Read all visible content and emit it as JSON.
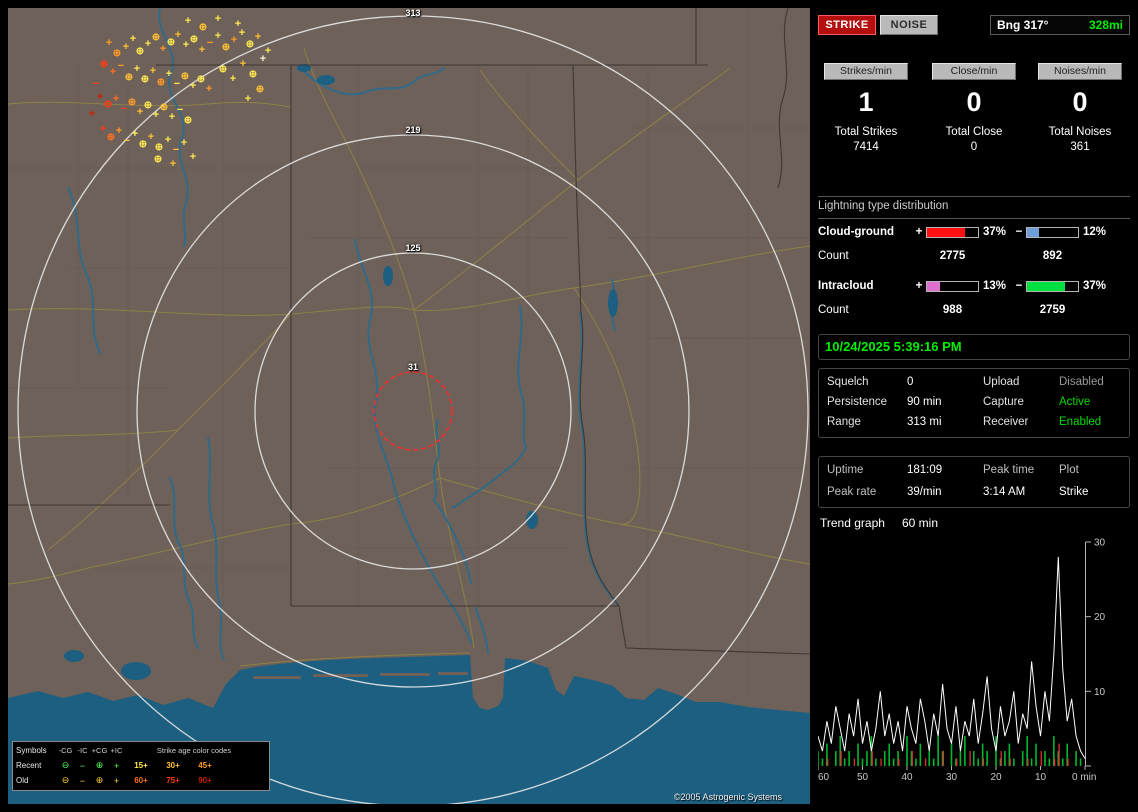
{
  "map": {
    "ring_labels": [
      "313",
      "219",
      "125",
      "31"
    ],
    "copyright": "©2005 Astrogenic Systems",
    "colors": {
      "land": "#6e6159",
      "water": "#1c5f80",
      "river": "#2d6b8c",
      "ring": "#e8e8e8",
      "alarm_ring": "#ff2a2a",
      "road": "#9b8f3d",
      "state_border": "#3b3633"
    },
    "age_palette": {
      "Y": "#ffe84f",
      "L": "#ffc133",
      "O": "#ff9a26",
      "D": "#ff6f1c",
      "R": "#ff3b12",
      "K": "#cc1e00",
      "W": "#fff3cf"
    },
    "legend": {
      "symbols_header": "Symbols",
      "col_headers": [
        "-CG",
        "-IC",
        "+CG",
        "+IC"
      ],
      "symbol_glyphs": [
        "⊖",
        "−",
        "⊕",
        "+"
      ],
      "age_header": "Strike age color codes",
      "rows": [
        {
          "label": "Recent",
          "ages": [
            "15+",
            "30+",
            "45+"
          ]
        },
        {
          "label": "Old",
          "ages": [
            "60+",
            "75+",
            "90+"
          ]
        }
      ],
      "age_colors": [
        "#ffe84f",
        "#ffc133",
        "#ff9a26",
        "#ff6f1c",
        "#ff3b12",
        "#cc1e00"
      ],
      "recent_symbol_color": "#55ff55",
      "old_symbol_color": "#ffd24a"
    },
    "strikes": [
      [
        101,
        34,
        "+",
        "O"
      ],
      [
        109,
        44,
        "⊕",
        "O"
      ],
      [
        118,
        38,
        "+",
        "L"
      ],
      [
        125,
        30,
        "+",
        "Y"
      ],
      [
        132,
        42,
        "⊕",
        "Y"
      ],
      [
        140,
        35,
        "+",
        "Y"
      ],
      [
        148,
        28,
        "⊕",
        "L"
      ],
      [
        155,
        40,
        "+",
        "O"
      ],
      [
        163,
        33,
        "⊕",
        "Y"
      ],
      [
        170,
        26,
        "+",
        "L"
      ],
      [
        178,
        36,
        "+",
        "Y"
      ],
      [
        186,
        30,
        "⊕",
        "Y"
      ],
      [
        194,
        41,
        "+",
        "L"
      ],
      [
        202,
        34,
        "−",
        "O"
      ],
      [
        210,
        27,
        "+",
        "Y"
      ],
      [
        218,
        38,
        "⊕",
        "L"
      ],
      [
        226,
        31,
        "+",
        "O"
      ],
      [
        234,
        24,
        "+",
        "Y"
      ],
      [
        242,
        35,
        "⊕",
        "Y"
      ],
      [
        250,
        28,
        "+",
        "L"
      ],
      [
        96,
        55,
        "⊕",
        "R"
      ],
      [
        105,
        63,
        "+",
        "D"
      ],
      [
        113,
        57,
        "−",
        "O"
      ],
      [
        121,
        68,
        "⊕",
        "L"
      ],
      [
        129,
        60,
        "+",
        "Y"
      ],
      [
        137,
        70,
        "⊕",
        "Y"
      ],
      [
        145,
        62,
        "+",
        "L"
      ],
      [
        153,
        73,
        "⊕",
        "O"
      ],
      [
        161,
        65,
        "+",
        "Y"
      ],
      [
        169,
        75,
        "−",
        "Y"
      ],
      [
        177,
        67,
        "⊕",
        "L"
      ],
      [
        185,
        77,
        "+",
        "Y"
      ],
      [
        193,
        70,
        "⊕",
        "Y"
      ],
      [
        201,
        80,
        "+",
        "O"
      ],
      [
        92,
        88,
        "+",
        "K"
      ],
      [
        100,
        95,
        "⊕",
        "R"
      ],
      [
        108,
        90,
        "+",
        "D"
      ],
      [
        116,
        100,
        "−",
        "R"
      ],
      [
        124,
        93,
        "⊕",
        "O"
      ],
      [
        132,
        103,
        "+",
        "L"
      ],
      [
        140,
        96,
        "⊕",
        "Y"
      ],
      [
        148,
        106,
        "+",
        "Y"
      ],
      [
        156,
        98,
        "⊕",
        "L"
      ],
      [
        164,
        108,
        "+",
        "Y"
      ],
      [
        172,
        101,
        "−",
        "Y"
      ],
      [
        180,
        111,
        "⊕",
        "Y"
      ],
      [
        95,
        120,
        "+",
        "R"
      ],
      [
        103,
        128,
        "⊕",
        "D"
      ],
      [
        111,
        122,
        "+",
        "O"
      ],
      [
        119,
        132,
        "−",
        "L"
      ],
      [
        127,
        125,
        "+",
        "Y"
      ],
      [
        135,
        135,
        "⊕",
        "Y"
      ],
      [
        143,
        128,
        "+",
        "L"
      ],
      [
        151,
        138,
        "⊕",
        "Y"
      ],
      [
        160,
        131,
        "+",
        "Y"
      ],
      [
        168,
        141,
        "−",
        "L"
      ],
      [
        176,
        134,
        "+",
        "Y"
      ],
      [
        150,
        150,
        "⊕",
        "Y"
      ],
      [
        165,
        155,
        "+",
        "L"
      ],
      [
        185,
        148,
        "+",
        "Y"
      ],
      [
        215,
        60,
        "⊕",
        "Y"
      ],
      [
        225,
        70,
        "+",
        "Y"
      ],
      [
        235,
        55,
        "+",
        "L"
      ],
      [
        245,
        65,
        "⊕",
        "Y"
      ],
      [
        255,
        50,
        "+",
        "W"
      ],
      [
        180,
        12,
        "+",
        "Y"
      ],
      [
        195,
        18,
        "⊕",
        "L"
      ],
      [
        210,
        10,
        "+",
        "Y"
      ],
      [
        230,
        15,
        "+",
        "Y"
      ],
      [
        88,
        75,
        "−",
        "R"
      ],
      [
        84,
        105,
        "+",
        "K"
      ],
      [
        240,
        90,
        "+",
        "Y"
      ],
      [
        252,
        80,
        "⊕",
        "L"
      ],
      [
        260,
        42,
        "+",
        "Y"
      ]
    ]
  },
  "panel": {
    "strike_button": "STRIKE",
    "noise_button": "NOISE",
    "bearing_label": "Bng 317°",
    "bearing_distance": "328mi",
    "colors": {
      "green": "#00ee00",
      "gray": "#9a9a9a",
      "strike_red": "#b30f0f"
    },
    "counters": [
      {
        "label": "Strikes/min",
        "value": "1",
        "total_label": "Total Strikes",
        "total": "7414"
      },
      {
        "label": "Close/min",
        "value": "0",
        "total_label": "Total Close",
        "total": "0"
      },
      {
        "label": "Noises/min",
        "value": "0",
        "total_label": "Total Noises",
        "total": "361"
      }
    ],
    "distribution": {
      "title": "Lightning type distribution",
      "rows": [
        {
          "label": "Cloud-ground",
          "plus": "+",
          "minus": "−",
          "pos_pct_text": "37%",
          "pos_val": 37,
          "pos_color": "#ff1010",
          "neg_pct_text": "12%",
          "neg_val": 12,
          "neg_color": "#6f9fd8",
          "count_label": "Count",
          "pos_count": "2775",
          "neg_count": "892"
        },
        {
          "label": "Intracloud",
          "plus": "+",
          "minus": "−",
          "pos_pct_text": "13%",
          "pos_val": 13,
          "pos_color": "#e070d0",
          "neg_pct_text": "37%",
          "neg_val": 37,
          "neg_color": "#00e040",
          "count_label": "Count",
          "pos_count": "988",
          "neg_count": "2759"
        }
      ]
    },
    "datetime": "10/24/2025 5:39:16 PM",
    "settings": [
      {
        "label": "Squelch",
        "value": "0",
        "label2": "Upload",
        "status": "Disabled",
        "status_color": "#9a9a9a"
      },
      {
        "label": "Persistence",
        "value": "90 min",
        "label2": "Capture",
        "status": "Active",
        "status_color": "#00dd00"
      },
      {
        "label": "Range",
        "value": "313 mi",
        "label2": "Receiver",
        "status": "Enabled",
        "status_color": "#00dd00"
      }
    ],
    "stats": {
      "rows": [
        {
          "c1": "Uptime",
          "c2": "181:09",
          "c3": "Peak time",
          "c4": "Plot"
        },
        {
          "c1": "Peak rate",
          "c2": "39/min",
          "c3": "3:14 AM",
          "c4": "Strike"
        }
      ]
    },
    "trend_label": "Trend graph",
    "trend_window": "60 min"
  },
  "chart_data": {
    "type": "line",
    "title": "Trend graph",
    "window_label": "60 min",
    "x_ticks": [
      60,
      50,
      40,
      30,
      20,
      10,
      0
    ],
    "axis_end_label": "0 min",
    "ylim": [
      0,
      30
    ],
    "y_ticks": [
      0,
      10,
      20,
      30
    ],
    "legend_position": "none",
    "series": [
      {
        "name": "strikes",
        "color": "#ffffff",
        "values": [
          4,
          2,
          6,
          3,
          8,
          5,
          2,
          7,
          4,
          9,
          3,
          6,
          2,
          5,
          10,
          4,
          7,
          3,
          6,
          2,
          8,
          5,
          3,
          9,
          6,
          2,
          7,
          4,
          11,
          5,
          3,
          8,
          2,
          6,
          4,
          9,
          3,
          7,
          12,
          5,
          2,
          8,
          4,
          6,
          10,
          3,
          7,
          5,
          14,
          8,
          4,
          10,
          6,
          15,
          28,
          13,
          6,
          9,
          4,
          2,
          1
        ]
      },
      {
        "name": "noises",
        "color": "#00b830",
        "values": [
          2,
          1,
          3,
          0,
          2,
          4,
          1,
          2,
          0,
          3,
          1,
          2,
          4,
          1,
          0,
          2,
          3,
          1,
          2,
          0,
          4,
          2,
          1,
          3,
          0,
          2,
          1,
          4,
          2,
          0,
          3,
          1,
          2,
          4,
          0,
          2,
          1,
          3,
          2,
          0,
          4,
          1,
          2,
          3,
          1,
          0,
          2,
          4,
          1,
          3,
          0,
          2,
          1,
          4,
          2,
          1,
          3,
          0,
          2,
          1,
          0
        ]
      },
      {
        "name": "close",
        "color": "#e03030",
        "values": [
          0,
          0,
          1,
          0,
          0,
          2,
          0,
          0,
          1,
          0,
          0,
          0,
          2,
          0,
          1,
          0,
          0,
          0,
          1,
          0,
          0,
          2,
          0,
          0,
          1,
          0,
          0,
          0,
          2,
          0,
          0,
          1,
          0,
          0,
          2,
          0,
          0,
          1,
          0,
          0,
          0,
          2,
          0,
          1,
          0,
          0,
          0,
          1,
          0,
          0,
          2,
          0,
          0,
          1,
          3,
          0,
          1,
          0,
          0,
          0,
          0
        ]
      }
    ]
  }
}
